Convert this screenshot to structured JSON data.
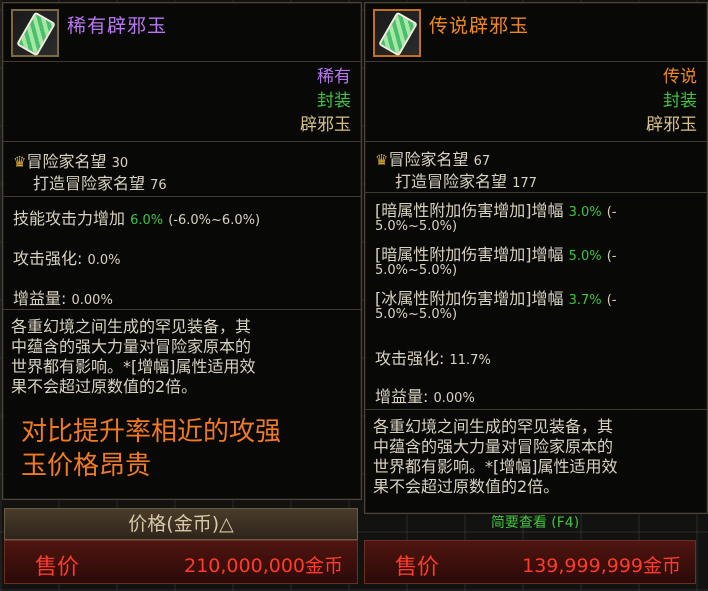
{
  "left_panel": {
    "title": "稀有辟邪玉",
    "rarity": "稀有",
    "sealed": "封装",
    "type": "辟邪玉",
    "fame_label": "冒险家名望",
    "fame_value": "30",
    "craft_fame_label": "打造冒险家名望",
    "craft_fame_value": "76",
    "stats": [
      {
        "label": "技能攻击力增加",
        "value": "6.0%",
        "range": "(-6.0%~6.0%)"
      },
      {
        "label": "攻击强化:",
        "value": "0.0%"
      },
      {
        "label": "增益量:",
        "value": "0.00%"
      }
    ],
    "description": [
      "各重幻境之间生成的罕见装备，其",
      "中蕴含的强大力量对冒险家原本的",
      "世界都有影响。*[增幅]属性适用效",
      "果不会超过原数值的2倍。"
    ],
    "annotation": [
      "对比提升率相近的攻强",
      "玉价格昂贵"
    ],
    "price_header": "价格(金币)△",
    "sale_label": "售价",
    "sale_price": "210,000,000金币"
  },
  "right_panel": {
    "title": "传说辟邪玉",
    "rarity": "传说",
    "sealed": "封装",
    "type": "辟邪玉",
    "fame_label": "冒险家名望",
    "fame_value": "67",
    "craft_fame_label": "打造冒险家名望",
    "craft_fame_value": "177",
    "stats": [
      {
        "label": "[暗属性附加伤害增加]增幅",
        "value": "3.0%",
        "range1": "(-",
        "range2": "5.0%~5.0%)"
      },
      {
        "label": "[暗属性附加伤害增加]增幅",
        "value": "5.0%",
        "range1": "(-",
        "range2": "5.0%~5.0%)"
      },
      {
        "label": "[冰属性附加伤害增加]增幅",
        "value": "3.7%",
        "range1": "(-",
        "range2": "5.0%~5.0%)"
      },
      {
        "label": "攻击强化:",
        "value": "11.7%"
      },
      {
        "label": "增益量:",
        "value": "0.00%"
      }
    ],
    "description": [
      "各重幻境之间生成的罕见装备，其",
      "中蕴含的强大力量对冒险家原本的",
      "世界都有影响。*[增幅]属性适用效",
      "果不会超过原数值的2倍。"
    ],
    "hint": "简要查看 (F4)",
    "sale_label": "售价",
    "sale_price": "139,999,999金币"
  },
  "colors": {
    "rare": "#b878f0",
    "legend": "#f08a20",
    "sealed": "#3ec43e",
    "price": "#ff3a2a",
    "annotation": "#f07a22"
  }
}
